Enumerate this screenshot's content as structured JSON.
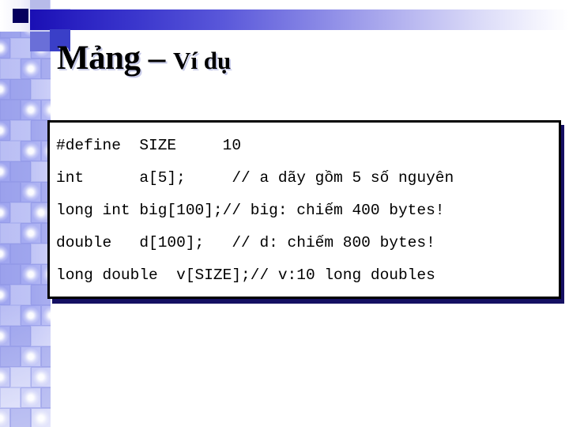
{
  "slide": {
    "title": {
      "main": "Mảng – ",
      "sub": "Ví dụ"
    },
    "code_block": {
      "lines": [
        "#define  SIZE     10",
        "int      a[5];     // a dãy gồm 5 số nguyên",
        "long int big[100];// big: chiếm 400 bytes!",
        "double   d[100];   // d: chiếm 800 bytes!",
        "long double  v[SIZE];// v:10 long doubles"
      ]
    },
    "colors": {
      "accent_blue": "#1a0fb4",
      "band_lavender": "#a7adf2",
      "shadow_navy": "#151063",
      "text_black": "#000000",
      "background": "#ffffff"
    }
  }
}
